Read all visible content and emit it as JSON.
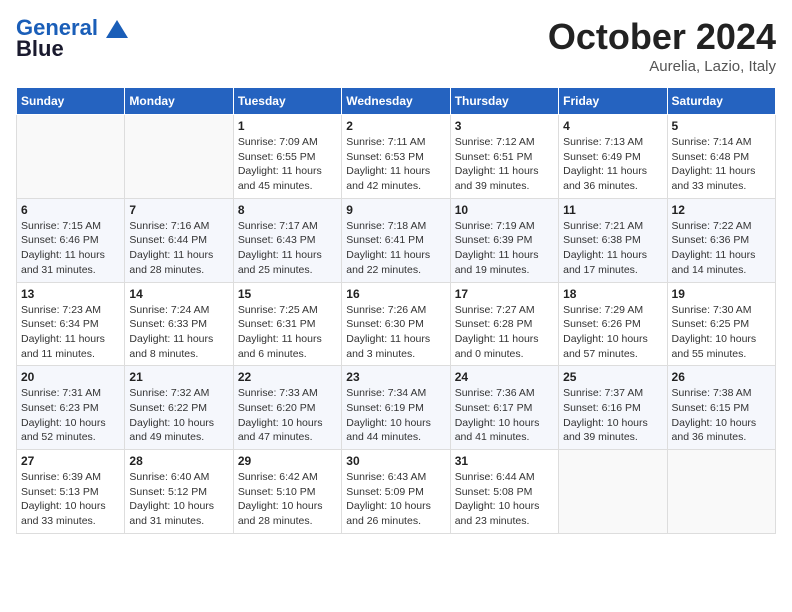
{
  "header": {
    "logo_line1": "General",
    "logo_line2": "Blue",
    "month": "October 2024",
    "location": "Aurelia, Lazio, Italy"
  },
  "weekdays": [
    "Sunday",
    "Monday",
    "Tuesday",
    "Wednesday",
    "Thursday",
    "Friday",
    "Saturday"
  ],
  "weeks": [
    [
      {
        "day": "",
        "info": ""
      },
      {
        "day": "",
        "info": ""
      },
      {
        "day": "1",
        "info": "Sunrise: 7:09 AM\nSunset: 6:55 PM\nDaylight: 11 hours and 45 minutes."
      },
      {
        "day": "2",
        "info": "Sunrise: 7:11 AM\nSunset: 6:53 PM\nDaylight: 11 hours and 42 minutes."
      },
      {
        "day": "3",
        "info": "Sunrise: 7:12 AM\nSunset: 6:51 PM\nDaylight: 11 hours and 39 minutes."
      },
      {
        "day": "4",
        "info": "Sunrise: 7:13 AM\nSunset: 6:49 PM\nDaylight: 11 hours and 36 minutes."
      },
      {
        "day": "5",
        "info": "Sunrise: 7:14 AM\nSunset: 6:48 PM\nDaylight: 11 hours and 33 minutes."
      }
    ],
    [
      {
        "day": "6",
        "info": "Sunrise: 7:15 AM\nSunset: 6:46 PM\nDaylight: 11 hours and 31 minutes."
      },
      {
        "day": "7",
        "info": "Sunrise: 7:16 AM\nSunset: 6:44 PM\nDaylight: 11 hours and 28 minutes."
      },
      {
        "day": "8",
        "info": "Sunrise: 7:17 AM\nSunset: 6:43 PM\nDaylight: 11 hours and 25 minutes."
      },
      {
        "day": "9",
        "info": "Sunrise: 7:18 AM\nSunset: 6:41 PM\nDaylight: 11 hours and 22 minutes."
      },
      {
        "day": "10",
        "info": "Sunrise: 7:19 AM\nSunset: 6:39 PM\nDaylight: 11 hours and 19 minutes."
      },
      {
        "day": "11",
        "info": "Sunrise: 7:21 AM\nSunset: 6:38 PM\nDaylight: 11 hours and 17 minutes."
      },
      {
        "day": "12",
        "info": "Sunrise: 7:22 AM\nSunset: 6:36 PM\nDaylight: 11 hours and 14 minutes."
      }
    ],
    [
      {
        "day": "13",
        "info": "Sunrise: 7:23 AM\nSunset: 6:34 PM\nDaylight: 11 hours and 11 minutes."
      },
      {
        "day": "14",
        "info": "Sunrise: 7:24 AM\nSunset: 6:33 PM\nDaylight: 11 hours and 8 minutes."
      },
      {
        "day": "15",
        "info": "Sunrise: 7:25 AM\nSunset: 6:31 PM\nDaylight: 11 hours and 6 minutes."
      },
      {
        "day": "16",
        "info": "Sunrise: 7:26 AM\nSunset: 6:30 PM\nDaylight: 11 hours and 3 minutes."
      },
      {
        "day": "17",
        "info": "Sunrise: 7:27 AM\nSunset: 6:28 PM\nDaylight: 11 hours and 0 minutes."
      },
      {
        "day": "18",
        "info": "Sunrise: 7:29 AM\nSunset: 6:26 PM\nDaylight: 10 hours and 57 minutes."
      },
      {
        "day": "19",
        "info": "Sunrise: 7:30 AM\nSunset: 6:25 PM\nDaylight: 10 hours and 55 minutes."
      }
    ],
    [
      {
        "day": "20",
        "info": "Sunrise: 7:31 AM\nSunset: 6:23 PM\nDaylight: 10 hours and 52 minutes."
      },
      {
        "day": "21",
        "info": "Sunrise: 7:32 AM\nSunset: 6:22 PM\nDaylight: 10 hours and 49 minutes."
      },
      {
        "day": "22",
        "info": "Sunrise: 7:33 AM\nSunset: 6:20 PM\nDaylight: 10 hours and 47 minutes."
      },
      {
        "day": "23",
        "info": "Sunrise: 7:34 AM\nSunset: 6:19 PM\nDaylight: 10 hours and 44 minutes."
      },
      {
        "day": "24",
        "info": "Sunrise: 7:36 AM\nSunset: 6:17 PM\nDaylight: 10 hours and 41 minutes."
      },
      {
        "day": "25",
        "info": "Sunrise: 7:37 AM\nSunset: 6:16 PM\nDaylight: 10 hours and 39 minutes."
      },
      {
        "day": "26",
        "info": "Sunrise: 7:38 AM\nSunset: 6:15 PM\nDaylight: 10 hours and 36 minutes."
      }
    ],
    [
      {
        "day": "27",
        "info": "Sunrise: 6:39 AM\nSunset: 5:13 PM\nDaylight: 10 hours and 33 minutes."
      },
      {
        "day": "28",
        "info": "Sunrise: 6:40 AM\nSunset: 5:12 PM\nDaylight: 10 hours and 31 minutes."
      },
      {
        "day": "29",
        "info": "Sunrise: 6:42 AM\nSunset: 5:10 PM\nDaylight: 10 hours and 28 minutes."
      },
      {
        "day": "30",
        "info": "Sunrise: 6:43 AM\nSunset: 5:09 PM\nDaylight: 10 hours and 26 minutes."
      },
      {
        "day": "31",
        "info": "Sunrise: 6:44 AM\nSunset: 5:08 PM\nDaylight: 10 hours and 23 minutes."
      },
      {
        "day": "",
        "info": ""
      },
      {
        "day": "",
        "info": ""
      }
    ]
  ]
}
